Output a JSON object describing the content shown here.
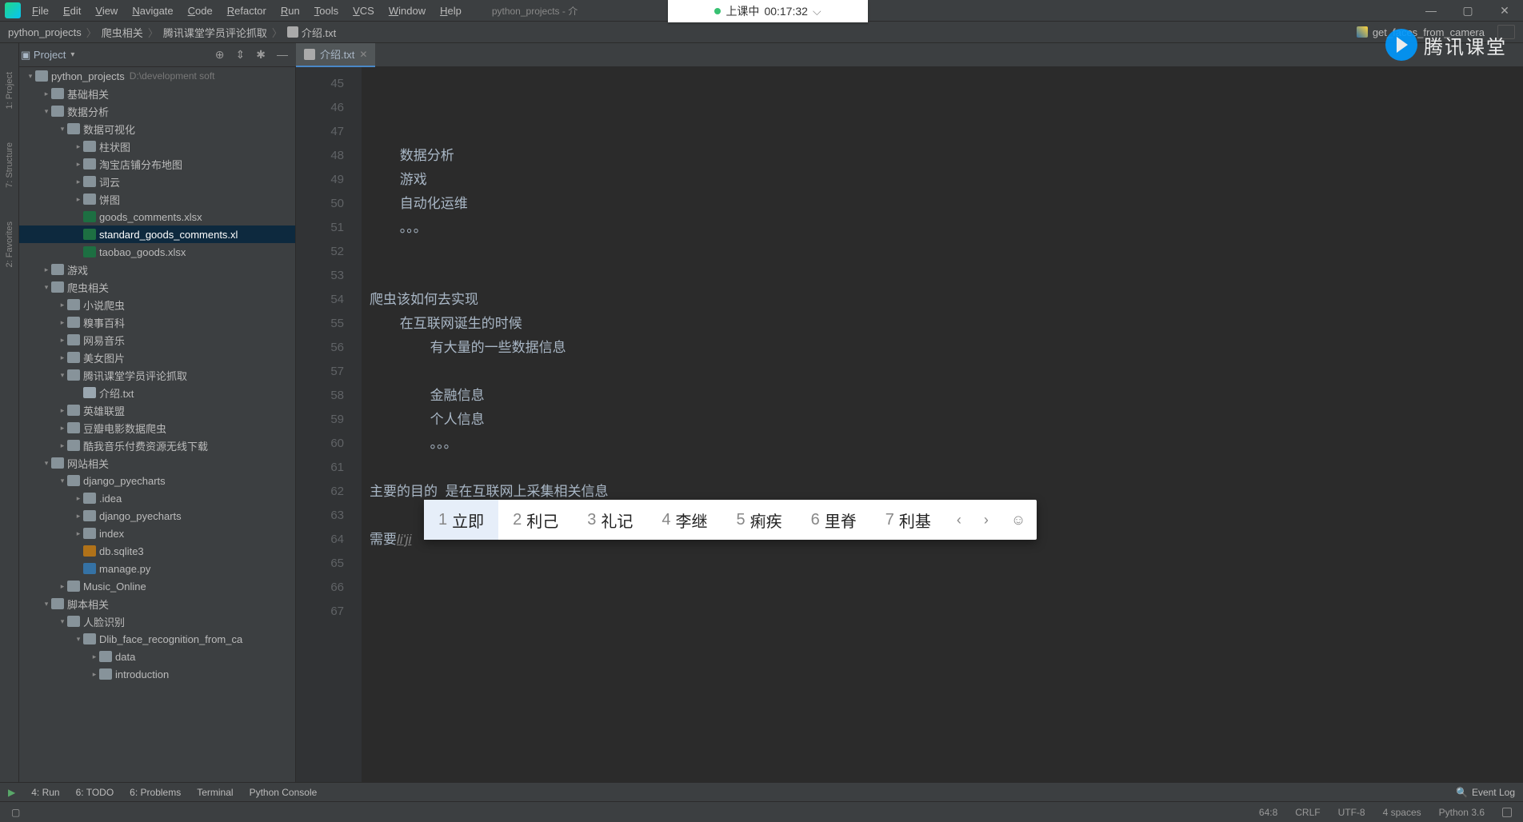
{
  "menu": [
    "File",
    "Edit",
    "View",
    "Navigate",
    "Code",
    "Refactor",
    "Run",
    "Tools",
    "VCS",
    "Window",
    "Help"
  ],
  "title_part": "python_projects - 介",
  "recording": {
    "label": "上课中",
    "time": "00:17:32"
  },
  "breadcrumb": [
    "python_projects",
    "爬虫相关",
    "腾讯课堂学员评论抓取",
    "介绍.txt"
  ],
  "run_config": "get_faces_from_camera",
  "project_toolwindow": "Project",
  "tab": {
    "name": "介绍.txt"
  },
  "tree": [
    {
      "d": 0,
      "t": "python_projects",
      "open": true,
      "ico": "fold-open",
      "path": "D:\\development soft"
    },
    {
      "d": 1,
      "t": "基础相关",
      "open": false,
      "ico": "fold"
    },
    {
      "d": 1,
      "t": "数据分析",
      "open": true,
      "ico": "fold-open"
    },
    {
      "d": 2,
      "t": "数据可视化",
      "open": true,
      "ico": "fold-open"
    },
    {
      "d": 3,
      "t": "柱状图",
      "open": false,
      "ico": "fold"
    },
    {
      "d": 3,
      "t": "淘宝店铺分布地图",
      "open": false,
      "ico": "fold"
    },
    {
      "d": 3,
      "t": "词云",
      "open": false,
      "ico": "fold"
    },
    {
      "d": 3,
      "t": "饼图",
      "open": false,
      "ico": "fold"
    },
    {
      "d": 3,
      "t": "goods_comments.xlsx",
      "ico": "xls"
    },
    {
      "d": 3,
      "t": "standard_goods_comments.xl",
      "ico": "xls",
      "sel": true
    },
    {
      "d": 3,
      "t": "taobao_goods.xlsx",
      "ico": "xls"
    },
    {
      "d": 1,
      "t": "游戏",
      "open": false,
      "ico": "fold"
    },
    {
      "d": 1,
      "t": "爬虫相关",
      "open": true,
      "ico": "fold-open"
    },
    {
      "d": 2,
      "t": "小说爬虫",
      "open": false,
      "ico": "fold"
    },
    {
      "d": 2,
      "t": "糗事百科",
      "open": false,
      "ico": "fold"
    },
    {
      "d": 2,
      "t": "网易音乐",
      "open": false,
      "ico": "fold"
    },
    {
      "d": 2,
      "t": "美女图片",
      "open": false,
      "ico": "fold"
    },
    {
      "d": 2,
      "t": "腾讯课堂学员评论抓取",
      "open": true,
      "ico": "fold-open"
    },
    {
      "d": 3,
      "t": "介绍.txt",
      "ico": "txt"
    },
    {
      "d": 2,
      "t": "英雄联盟",
      "open": false,
      "ico": "fold"
    },
    {
      "d": 2,
      "t": "豆瓣电影数据爬虫",
      "open": false,
      "ico": "fold"
    },
    {
      "d": 2,
      "t": "酷我音乐付费资源无线下载",
      "open": false,
      "ico": "fold"
    },
    {
      "d": 1,
      "t": "网站相关",
      "open": true,
      "ico": "fold-open"
    },
    {
      "d": 2,
      "t": "django_pyecharts",
      "open": true,
      "ico": "fold-open"
    },
    {
      "d": 3,
      "t": ".idea",
      "open": false,
      "ico": "fold"
    },
    {
      "d": 3,
      "t": "django_pyecharts",
      "open": false,
      "ico": "fold"
    },
    {
      "d": 3,
      "t": "index",
      "open": false,
      "ico": "fold"
    },
    {
      "d": 3,
      "t": "db.sqlite3",
      "ico": "db"
    },
    {
      "d": 3,
      "t": "manage.py",
      "ico": "py"
    },
    {
      "d": 2,
      "t": "Music_Online",
      "open": false,
      "ico": "fold"
    },
    {
      "d": 1,
      "t": "脚本相关",
      "open": true,
      "ico": "fold-open"
    },
    {
      "d": 2,
      "t": "人脸识别",
      "open": true,
      "ico": "fold-open"
    },
    {
      "d": 3,
      "t": "Dlib_face_recognition_from_ca",
      "open": true,
      "ico": "fold-open"
    },
    {
      "d": 4,
      "t": "data",
      "open": false,
      "ico": "fold"
    },
    {
      "d": 4,
      "t": "introduction",
      "open": false,
      "ico": "fold"
    }
  ],
  "gutter_start": 45,
  "code_lines": [
    "",
    "",
    "",
    "        数据分析",
    "        游戏",
    "        自动化运维",
    "        。。。",
    "",
    "",
    "爬虫该如何去实现",
    "        在互联网诞生的时候",
    "                有大量的一些数据信息",
    "",
    "                金融信息",
    "                个人信息",
    "                。。。",
    "",
    "主要的目的  是在互联网上采集相关信息",
    "",
    {
      "prefix": "需要",
      "ime": "li'ji"
    },
    "",
    "",
    ""
  ],
  "ime_candidates": [
    {
      "n": "1",
      "w": "立即"
    },
    {
      "n": "2",
      "w": "利己"
    },
    {
      "n": "3",
      "w": "礼记"
    },
    {
      "n": "4",
      "w": "李继"
    },
    {
      "n": "5",
      "w": "痢疾"
    },
    {
      "n": "6",
      "w": "里脊"
    },
    {
      "n": "7",
      "w": "利基"
    }
  ],
  "left_strip": [
    "1: Project",
    "7: Structure",
    "2: Favorites"
  ],
  "bottom_tools": [
    {
      "label": "4: Run",
      "u": "R"
    },
    {
      "label": "6: TODO"
    },
    {
      "label": "6: Problems",
      "u": "P"
    },
    {
      "label": "Terminal"
    },
    {
      "label": "Python Console"
    }
  ],
  "event_log": "Event Log",
  "status": {
    "pos": "64:8",
    "eol": "CRLF",
    "enc": "UTF-8",
    "indent": "4 spaces",
    "python": "Python 3.6"
  },
  "watermark": "腾讯课堂"
}
